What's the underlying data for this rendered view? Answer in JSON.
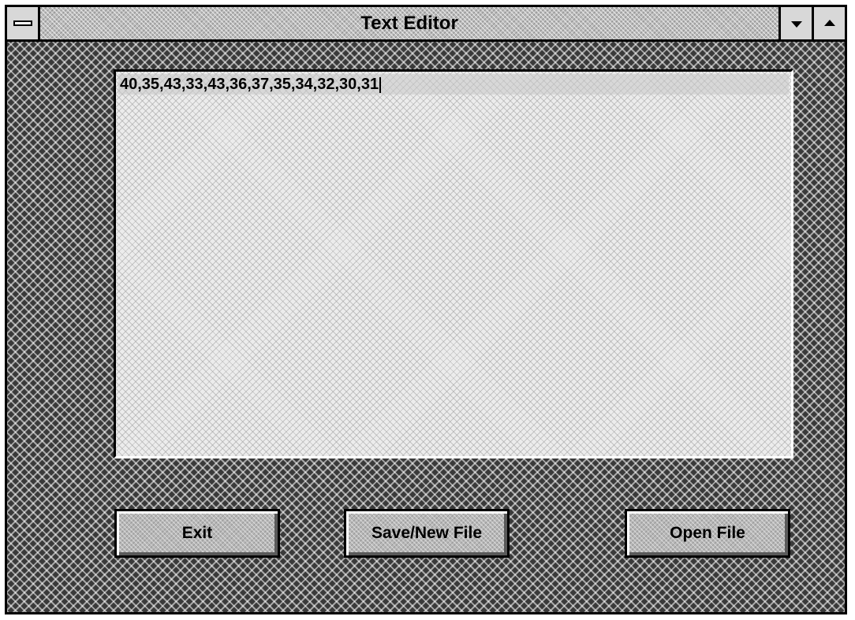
{
  "window": {
    "title": "Text Editor"
  },
  "titlebar": {
    "system_menu_icon": "system-menu-icon",
    "minimize_icon": "minimize-arrow-icon",
    "maximize_icon": "maximize-arrow-icon"
  },
  "editor": {
    "content": "40,35,43,33,43,36,37,35,34,32,30,31"
  },
  "buttons": {
    "exit_label": "Exit",
    "save_label": "Save/New File",
    "open_label": "Open File"
  }
}
